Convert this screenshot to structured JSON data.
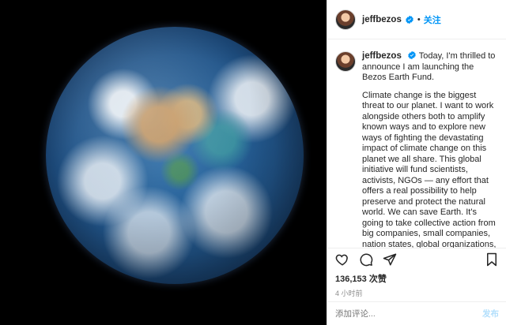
{
  "post": {
    "image_alt": "Earth from space",
    "author": {
      "username": "jeffbezos",
      "verified": true,
      "follow_label": "关注",
      "dot": "•"
    },
    "caption": {
      "first_line": "Today, I'm thrilled to announce I am launching the Bezos Earth Fund.",
      "body": "Climate change is the biggest threat to our planet. I want to work alongside others both to amplify known ways and to explore new ways of fighting the devastating impact of climate change on this planet we all share. This global initiative will fund scientists, activists, NGOs — any effort that offers a real possibility to help preserve and protect the natural world. We can save Earth. It's going to take collective action from big companies, small companies, nation states, global organizations, and individuals."
    },
    "stats": {
      "likes_text": "136,153 次赞",
      "time_text": "4 小时前"
    },
    "comment": {
      "placeholder": "添加评论...",
      "post_label": "发布"
    },
    "colors": {
      "accent": "#0095f6",
      "muted": "#8e8e8e",
      "border": "#efefef"
    },
    "icons": [
      "heart-icon",
      "comment-icon",
      "share-icon",
      "bookmark-icon",
      "verified-badge-icon"
    ]
  }
}
